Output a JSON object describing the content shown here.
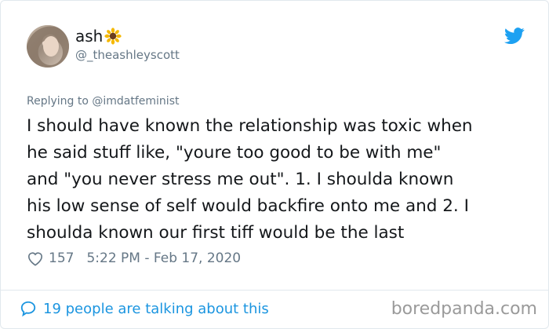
{
  "user": {
    "display_name": "ash",
    "name_emoji": "sunflower-emoji",
    "handle": "@_theashleyscott"
  },
  "tweet": {
    "replying_to": "Replying to @imdatfeminist",
    "text": "I should have known the relationship was toxic when\nhe said stuff like, \"youre too good to be with me\"\nand \"you never stress me out\". 1. I shoulda known\nhis low sense of self would backfire onto me and 2. I\nshoulda known our first tiff would be the last",
    "likes": "157",
    "timestamp": "5:22 PM - Feb 17, 2020"
  },
  "footer": {
    "talking": "19 people are talking about this",
    "watermark": "boredpanda.com"
  },
  "colors": {
    "twitter_blue": "#1da1f2",
    "link_blue": "#1b95e0",
    "secondary_text": "#657786"
  }
}
